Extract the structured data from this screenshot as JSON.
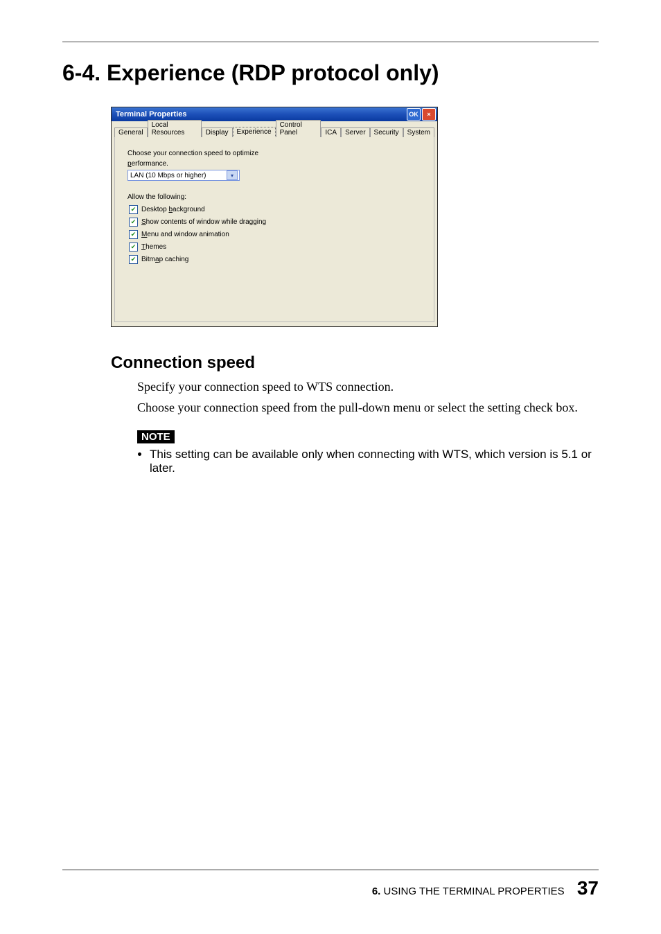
{
  "heading": "6-4. Experience (RDP protocol only)",
  "dialog": {
    "title": "Terminal Properties",
    "ok": "OK",
    "close": "×",
    "tabs": {
      "general": "General",
      "local_resources": "Local Resources",
      "display": "Display",
      "experience": "Experience",
      "control_panel": "Control Panel",
      "ica": "ICA",
      "server": "Server",
      "security": "Security",
      "system": "System"
    },
    "speed_label_1": "Choose your connection speed to optimize",
    "speed_label_2": "performance.",
    "speed_value": "LAN (10 Mbps or higher)",
    "allow_label": "Allow the following:",
    "checks": {
      "desktop_bg": "Desktop background",
      "show_contents": "Show contents of window while dragging",
      "menu_anim": "Menu and window animation",
      "themes": "Themes",
      "bitmap": "Bitmap caching"
    }
  },
  "subhead": "Connection speed",
  "body1": "Specify your connection speed to WTS connection.",
  "body2": "Choose your connection speed from the pull-down menu or select the setting check box.",
  "note_badge": "NOTE",
  "note_item": "This setting can be available only when connecting with WTS, which version is 5.1 or later.",
  "footer": {
    "chapter_num": "6.",
    "chapter_title": " USING THE TERMINAL PROPERTIES",
    "page": "37"
  }
}
